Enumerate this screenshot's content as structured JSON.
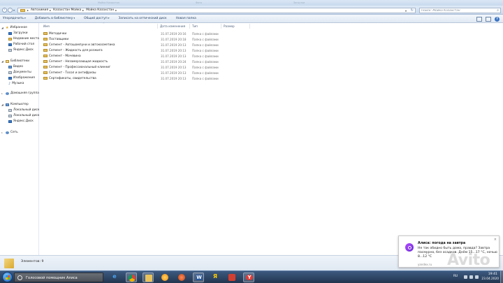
{
  "window": {
    "faded_tabs": [
      "Мойка Казахстан",
      "Фото",
      "Загрузки"
    ]
  },
  "address_bar": {
    "breadcrumbs": [
      "Автохимия",
      "Казахстан Мойка",
      "Мойка Казахстан"
    ],
    "search_placeholder": "Поиск: Мойка Казахстан"
  },
  "toolbar": {
    "organize": "Упорядочить",
    "add_to_library": "Добавить в библиотеку",
    "share": "Общий доступ",
    "burn": "Записать на оптический диск",
    "new_folder": "Новая папка"
  },
  "sidebar": {
    "favorites": {
      "label": "Избранное",
      "items": [
        "Загрузки",
        "Недавние места",
        "Рабочий стол",
        "Яндекс.Диск"
      ]
    },
    "libraries": {
      "label": "Библиотеки",
      "items": [
        "Видео",
        "Документы",
        "Изображения",
        "Музыка"
      ]
    },
    "homegroup": "Домашняя группа",
    "computer": {
      "label": "Компьютер",
      "items": [
        "Локальный диск",
        "Локальный диск",
        "Яндекс.Диск"
      ]
    },
    "network": "Сеть"
  },
  "file_list": {
    "columns": {
      "name": "Имя",
      "date": "Дата изменения",
      "type": "Тип",
      "size": "Размер"
    },
    "rows": [
      {
        "name": "Методички",
        "date": "31.07.2019 20:16",
        "type": "Папка с файлами"
      },
      {
        "name": "Поставщики",
        "date": "31.07.2019 20:18",
        "type": "Папка с файлами"
      },
      {
        "name": "Сегмент - Автошампуни и автокосметика",
        "date": "31.07.2019 20:13",
        "type": "Папка с файлами"
      },
      {
        "name": "Сегмент - Жидкость для розжига",
        "date": "31.07.2019 20:13",
        "type": "Папка с файлами"
      },
      {
        "name": "Сегмент - Мочевина",
        "date": "31.07.2019 20:13",
        "type": "Папка с файлами"
      },
      {
        "name": "Сегмент - Незамерзающая жидкость",
        "date": "31.07.2019 20:24",
        "type": "Папка с файлами"
      },
      {
        "name": "Сегмент - Профессиональный клинниг",
        "date": "31.07.2019 20:13",
        "type": "Папка с файлами"
      },
      {
        "name": "Сегмент - Тосол и антифризы",
        "date": "31.07.2019 20:13",
        "type": "Папка с файлами"
      },
      {
        "name": "Сертификаты, свидетельства",
        "date": "31.07.2019 20:13",
        "type": "Папка с файлами"
      }
    ]
  },
  "details": {
    "items_count": "Элементов: 9"
  },
  "notification": {
    "title": "Алиса: погода на завтра",
    "body": "Не так обидно быть дома, правда? Завтра пасмурно, без осадков. Днём 15...17 °C, ночью 8...12 °C",
    "source": "yandex.ru"
  },
  "watermark": "Avito",
  "taskbar": {
    "search_label": "Голосовой помощник Алиса",
    "language": "RU",
    "time": "19:41",
    "date": "23.04.2020",
    "apps": [
      "ie-icon",
      "chrome-icon",
      "explorer-icon",
      "media-player-icon",
      "app-icon",
      "word-icon",
      "yandex-music-icon",
      "app-icon",
      "yandex-browser-icon"
    ]
  },
  "colors": {
    "taskbar": "#22354f",
    "folder": "#e8c25c",
    "alice": "#8a3cf0",
    "toolbar_text": "#1e395b"
  }
}
